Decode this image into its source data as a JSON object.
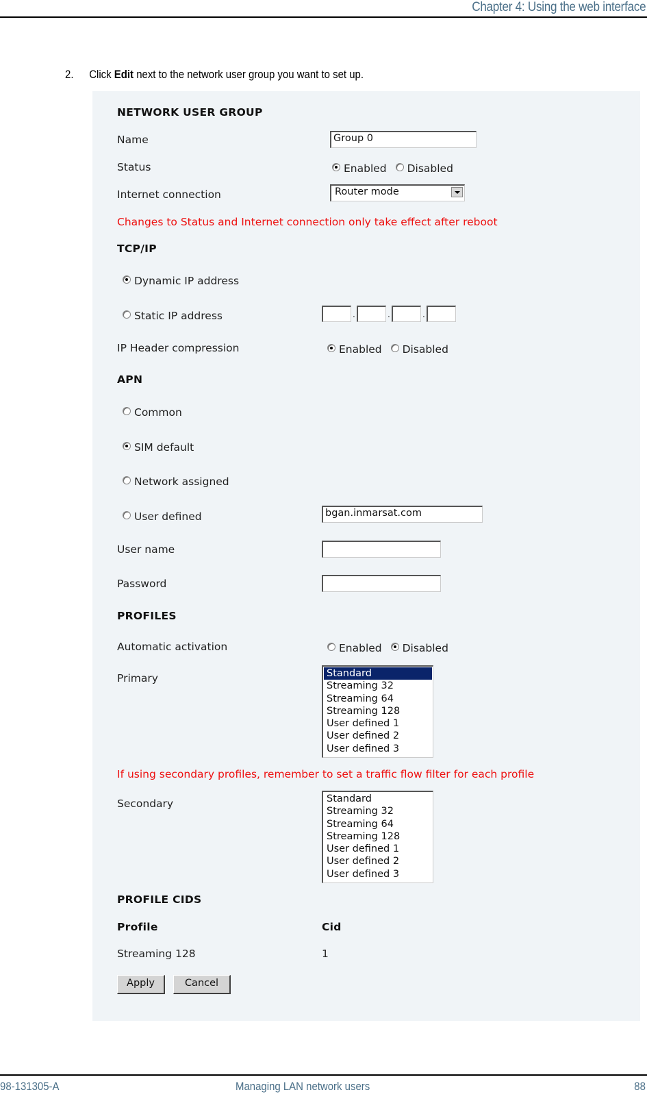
{
  "page_header": {
    "chapter": "Chapter 4: Using the web interface"
  },
  "instruction": {
    "number": "2.",
    "prefix": "Click ",
    "bold": "Edit",
    "suffix": " next to the network user group you want to set up."
  },
  "form": {
    "network_user_group": {
      "heading": "NETWORK USER GROUP",
      "name_label": "Name",
      "name_value": "Group 0",
      "status_label": "Status",
      "status_options": [
        "Enabled",
        "Disabled"
      ],
      "status_selected": "Enabled",
      "internet_label": "Internet connection",
      "internet_value": "Router mode",
      "warning": "Changes to Status and Internet connection only take effect after reboot"
    },
    "tcpip": {
      "heading": "TCP/IP",
      "dynamic_label": "Dynamic IP address",
      "static_label": "Static IP address",
      "selected": "Dynamic IP address",
      "ip_octets": [
        "",
        "",
        "",
        ""
      ],
      "ip_separator": ".",
      "compression_label": "IP Header compression",
      "compression_options": [
        "Enabled",
        "Disabled"
      ],
      "compression_selected": "Enabled"
    },
    "apn": {
      "heading": "APN",
      "options": [
        "Common",
        "SIM default",
        "Network assigned",
        "User defined"
      ],
      "selected": "SIM default",
      "user_defined_value": "bgan.inmarsat.com",
      "username_label": "User name",
      "username_value": "",
      "password_label": "Password",
      "password_value": ""
    },
    "profiles": {
      "heading": "PROFILES",
      "auto_label": "Automatic activation",
      "auto_options": [
        "Enabled",
        "Disabled"
      ],
      "auto_selected": "Disabled",
      "primary_label": "Primary",
      "primary_options": [
        "Standard",
        "Streaming 32",
        "Streaming 64",
        "Streaming 128",
        "User defined 1",
        "User defined 2",
        "User defined 3"
      ],
      "primary_selected": "Standard",
      "secondary_warning": "If using secondary profiles, remember to set a traffic flow filter for each profile",
      "secondary_label": "Secondary",
      "secondary_options": [
        "Standard",
        "Streaming 32",
        "Streaming 64",
        "Streaming 128",
        "User defined 1",
        "User defined 2",
        "User defined 3"
      ]
    },
    "profile_cids": {
      "heading": "PROFILE CIDS",
      "columns": [
        "Profile",
        "Cid"
      ],
      "rows": [
        {
          "profile": "Streaming 128",
          "cid": "1"
        }
      ]
    },
    "buttons": {
      "apply": "Apply",
      "cancel": "Cancel"
    }
  },
  "page_footer": {
    "doc_number": "98-131305-A",
    "section": "Managing LAN network users",
    "page": "88"
  }
}
